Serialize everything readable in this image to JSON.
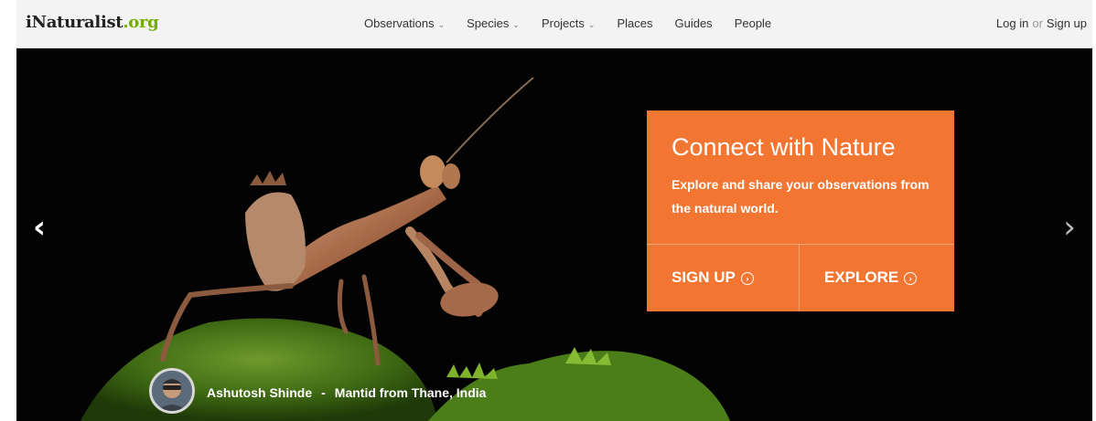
{
  "header": {
    "logo": {
      "prefix": "iNaturalist",
      "suffix": ".org"
    },
    "nav": [
      {
        "label": "Observations",
        "dropdown": true
      },
      {
        "label": "Species",
        "dropdown": true
      },
      {
        "label": "Projects",
        "dropdown": true
      },
      {
        "label": "Places",
        "dropdown": false
      },
      {
        "label": "Guides",
        "dropdown": false
      },
      {
        "label": "People",
        "dropdown": false
      }
    ],
    "auth": {
      "login": "Log in",
      "or": "or",
      "signup": "Sign up"
    }
  },
  "hero": {
    "prev_icon": "chevron-left-icon",
    "next_icon": "chevron-right-icon",
    "cta": {
      "title": "Connect with Nature",
      "subtitle": "Explore and share your observations from the natural world.",
      "signup_label": "SIGN UP",
      "explore_label": "EXPLORE",
      "button_icon": "arrow-circle-right-icon",
      "color": "#f27531"
    },
    "caption": {
      "photographer": "Ashutosh Shinde",
      "separator": "-",
      "description": "Mantid from Thane, India"
    }
  },
  "colors": {
    "brand_green": "#74ac00",
    "hero_bg": "#030303",
    "nav_bg": "#f3f3f3"
  }
}
